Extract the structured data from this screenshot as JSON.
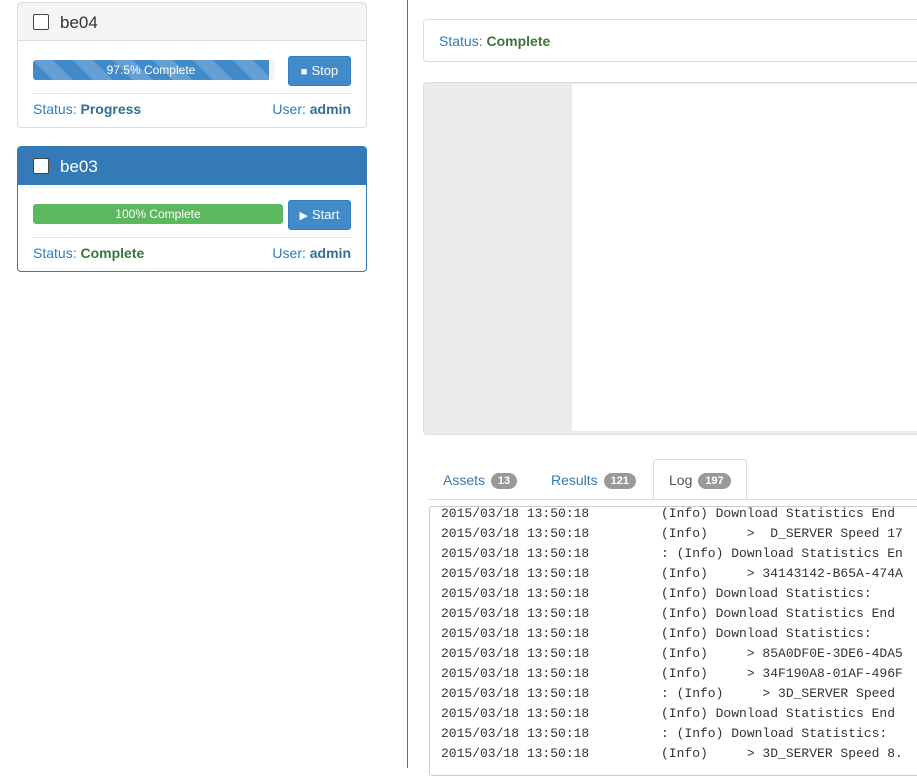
{
  "jobs": [
    {
      "name": "be04",
      "progress_percent": 97.5,
      "progress_label": "97.5% Complete",
      "button_label": "Stop",
      "button_icon": "stop-icon",
      "status_label": "Status:",
      "status_value": "Progress",
      "user_label": "User:",
      "user_value": "admin",
      "selected": false
    },
    {
      "name": "be03",
      "progress_percent": 100,
      "progress_label": "100% Complete",
      "button_label": "Start",
      "button_icon": "play-icon",
      "status_label": "Status:",
      "status_value": "Complete",
      "user_label": "User:",
      "user_value": "admin",
      "selected": true
    }
  ],
  "detail": {
    "status_label": "Status:",
    "status_value": "Complete"
  },
  "tabs": [
    {
      "label": "Assets",
      "count": "13"
    },
    {
      "label": "Results",
      "count": "121"
    },
    {
      "label": "Log",
      "count": "197",
      "active": true
    }
  ],
  "log_lines": [
    {
      "ts": "2015/03/18 13:50:18",
      "msg": "(Info) Download Statistics End"
    },
    {
      "ts": "2015/03/18 13:50:18",
      "msg": "(Info)     >  D_SERVER Speed 17"
    },
    {
      "ts": "2015/03/18 13:50:18",
      "msg": ": (Info) Download Statistics En"
    },
    {
      "ts": "2015/03/18 13:50:18",
      "msg": "(Info)     > 34143142-B65A-474A"
    },
    {
      "ts": "2015/03/18 13:50:18",
      "msg": "(Info) Download Statistics:"
    },
    {
      "ts": "2015/03/18 13:50:18",
      "msg": "(Info) Download Statistics End"
    },
    {
      "ts": "2015/03/18 13:50:18",
      "msg": "(Info) Download Statistics:"
    },
    {
      "ts": "2015/03/18 13:50:18",
      "msg": "(Info)     > 85A0DF0E-3DE6-4DA5"
    },
    {
      "ts": "2015/03/18 13:50:18",
      "msg": "(Info)     > 34F190A8-01AF-496F"
    },
    {
      "ts": "2015/03/18 13:50:18",
      "msg": ": (Info)     > 3D_SERVER Speed"
    },
    {
      "ts": "2015/03/18 13:50:18",
      "msg": "(Info) Download Statistics End"
    },
    {
      "ts": "2015/03/18 13:50:18",
      "msg": ": (Info) Download Statistics:"
    },
    {
      "ts": "2015/03/18 13:50:18",
      "msg": "(Info)     > 3D_SERVER Speed 8."
    }
  ],
  "colors": {
    "primary": "#337ab7",
    "progress_blue": "#428bca",
    "progress_green": "#5cb85c",
    "status_complete": "#3c763d",
    "status_progress": "#31708f"
  }
}
